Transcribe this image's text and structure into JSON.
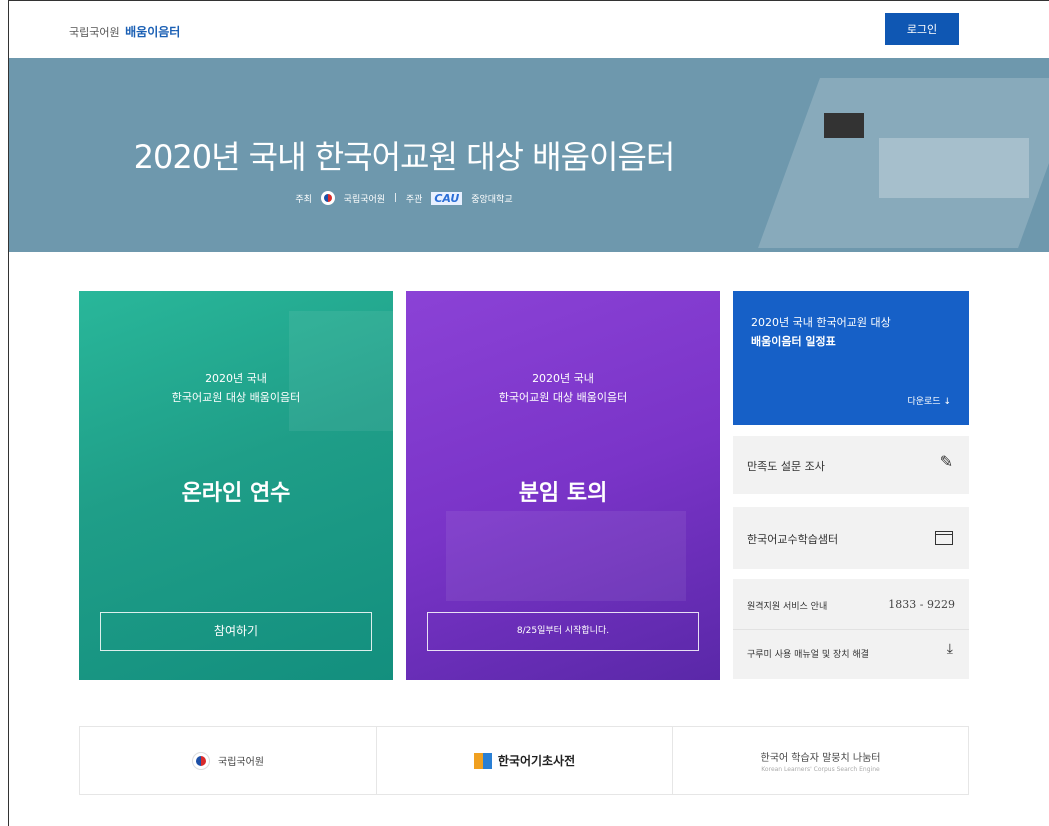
{
  "header": {
    "brand_prefix": "국립국어원",
    "brand_highlight": "배움이음터",
    "login_label": "로그인"
  },
  "hero": {
    "title": "2020년 국내 한국어교원 대상 배움이음터",
    "host_label": "주최",
    "host_name": "국립국어원",
    "organizer_label": "주관",
    "organizer_logo_text": "CAU",
    "organizer_name": "중앙대학교"
  },
  "cards": [
    {
      "small_line1": "2020년 국내",
      "small_line2": "한국어교원 대상 배움이음터",
      "big": "온라인 연수",
      "button": "참여하기"
    },
    {
      "small_line1": "2020년 국내",
      "small_line2": "한국어교원 대상 배움이음터",
      "big": "분임 토의",
      "button": "8/25일부터 시작합니다."
    }
  ],
  "right_panel": {
    "schedule_line1": "2020년 국내 한국어교원 대상",
    "schedule_line2": "배움이음터 일정표",
    "download_label": "다운로드",
    "download_icon": "↓",
    "survey_label": "만족도 설문 조사",
    "survey_icon": "pencil-icon",
    "center_label": "한국어교수학습샘터",
    "center_icon": "window-icon",
    "support_label": "원격지원 서비스 안내",
    "support_phone": "1833 - 9229",
    "manual_label": "구루미 사용 매뉴얼 및 장치 해결",
    "manual_icon": "download-icon"
  },
  "footer": {
    "logo1_text": "국립국어원",
    "logo2_text": "한국어기초사전",
    "logo3_text": "한국어 학습자 말뭉치 나눔터",
    "logo3_sub": "Korean Learners' Corpus Search Engine"
  },
  "colors": {
    "login_bg": "#0f57b3",
    "hero_bg": "#6e98ad",
    "teal": "#1f9e88",
    "purple": "#7a34c8",
    "schedule_bg": "#1660c7"
  }
}
